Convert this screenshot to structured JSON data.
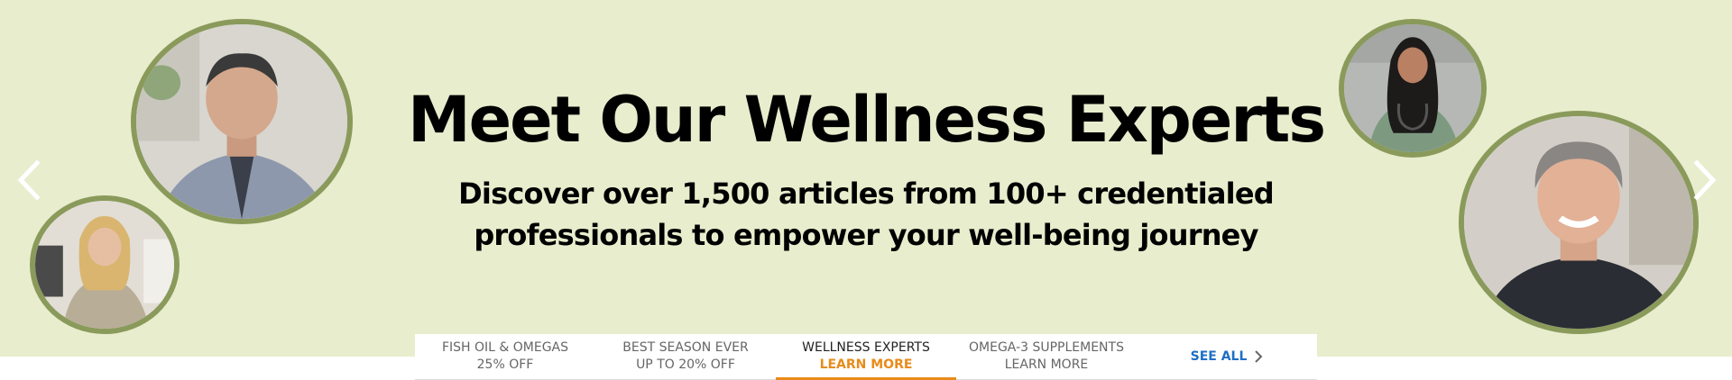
{
  "hero": {
    "title": "Meet Our Wellness Experts",
    "subtitle_line1": "Discover over 1,500 articles from 100+ credentialed",
    "subtitle_line2": "professionals to empower your well-being journey",
    "background_color": "#e8edcd",
    "frame_color": "#8a9a5b"
  },
  "carousel": {
    "prev_icon": "chevron-left-icon",
    "next_icon": "chevron-right-icon"
  },
  "tabs": [
    {
      "label": "FISH OIL & OMEGAS",
      "sub": "25% OFF"
    },
    {
      "label": "BEST SEASON EVER",
      "sub": "UP TO 20% OFF"
    },
    {
      "label": "WELLNESS EXPERTS",
      "sub": "LEARN MORE"
    },
    {
      "label": "OMEGA-3 SUPPLEMENTS",
      "sub": "LEARN MORE"
    }
  ],
  "see_all": {
    "label": "SEE ALL",
    "color": "#1f6fc5"
  },
  "accent_color": "#e88b1a"
}
